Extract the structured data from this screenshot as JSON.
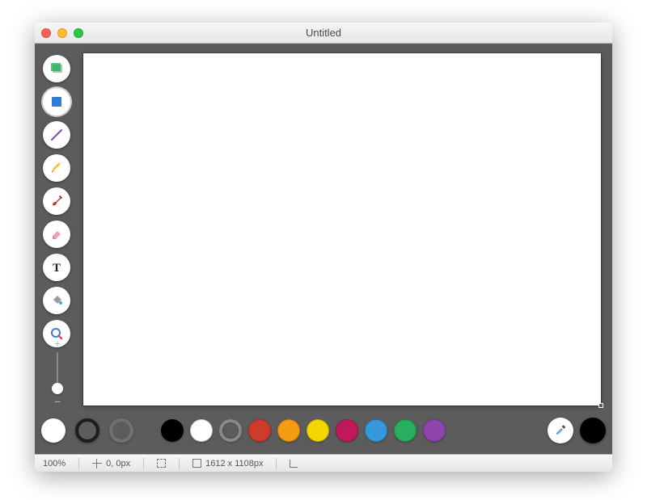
{
  "window": {
    "title": "Untitled"
  },
  "tools": [
    {
      "id": "selection",
      "icon": "selection-icon",
      "selected": false,
      "stacked": true
    },
    {
      "id": "shape",
      "icon": "shape-icon",
      "selected": true,
      "stacked": true
    },
    {
      "id": "line",
      "icon": "line-icon",
      "selected": false,
      "stacked": true
    },
    {
      "id": "pencil",
      "icon": "pencil-icon",
      "selected": false,
      "stacked": false
    },
    {
      "id": "brush",
      "icon": "brush-icon",
      "selected": false,
      "stacked": false
    },
    {
      "id": "eraser",
      "icon": "eraser-icon",
      "selected": false,
      "stacked": false
    },
    {
      "id": "text",
      "icon": "text-icon",
      "selected": false,
      "stacked": false
    },
    {
      "id": "fill",
      "icon": "fill-icon",
      "selected": false,
      "stacked": false
    },
    {
      "id": "zoom",
      "icon": "zoom-icon",
      "selected": false,
      "stacked": false
    }
  ],
  "stroke_fill": {
    "fill_color": "#ffffff",
    "stroke_color": "#1c1c1c",
    "secondary_stroke": "#7a7a7a"
  },
  "palette": [
    {
      "name": "black",
      "hex": "#000000"
    },
    {
      "name": "white",
      "hex": "#ffffff"
    },
    {
      "name": "gray-ring",
      "hex": "ring"
    },
    {
      "name": "red",
      "hex": "#d03a2b"
    },
    {
      "name": "orange",
      "hex": "#f39c12"
    },
    {
      "name": "yellow",
      "hex": "#f2d600"
    },
    {
      "name": "magenta",
      "hex": "#c2185b"
    },
    {
      "name": "blue",
      "hex": "#3498db"
    },
    {
      "name": "green",
      "hex": "#27ae60"
    },
    {
      "name": "purple",
      "hex": "#8e44ad"
    }
  ],
  "current_color": "#000000",
  "status": {
    "zoom": "100%",
    "cursor_pos": "0, 0px",
    "canvas_size": "1612 x 1108px"
  }
}
